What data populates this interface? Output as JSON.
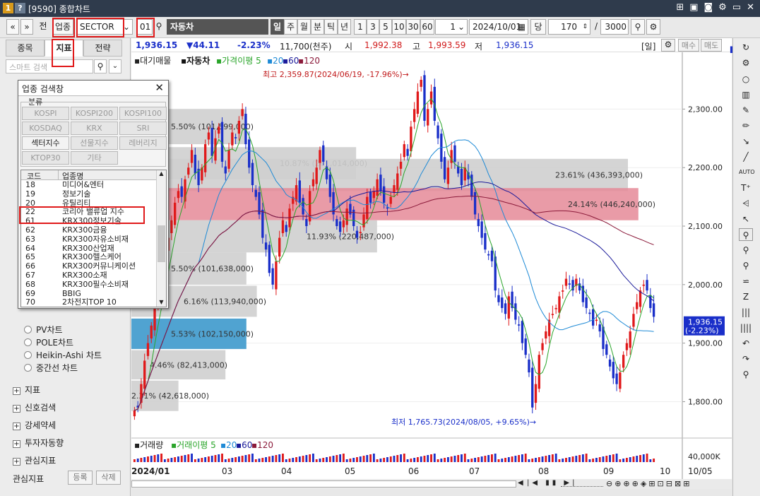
{
  "window": {
    "code": "[9590]",
    "title": "종합차트",
    "icons": [
      "pin-icon",
      "note-icon",
      "camera-icon",
      "gear-icon",
      "minimize-icon",
      "close-icon"
    ]
  },
  "toolbar": {
    "prev_label": "«",
    "next_label": "»",
    "before_label": "전",
    "type_label": "업종",
    "sector_value": "SECTOR",
    "code_value": "01",
    "name_value": "자동차",
    "period_buttons": [
      "일",
      "주",
      "월",
      "분",
      "틱",
      "년"
    ],
    "interval_buttons": [
      "1",
      "3",
      "5",
      "10",
      "30",
      "60"
    ],
    "interval_value": "1",
    "date_value": "2024/10/01",
    "unit_label": "당",
    "count_value": "170",
    "slash": "/",
    "max_value": "3000"
  },
  "quote": {
    "price": "1,936.15",
    "change": "▼44.11",
    "rate": "-2.23%",
    "volume": "11,700(천주)",
    "open_label": "시",
    "open": "1,992.38",
    "high_label": "고",
    "high": "1,993.59",
    "low_label": "저",
    "low": "1,936.15",
    "period_tag": "[일]",
    "buy_label": "매수",
    "sell_label": "매도"
  },
  "left": {
    "tabs": [
      "종목",
      "지표",
      "전략"
    ],
    "search_placeholder": "스마트 검색",
    "radios": [
      "PV차트",
      "POLE차트",
      "Heikin-Ashi 차트",
      "중간선 차트"
    ],
    "tree": [
      "지표",
      "신호검색",
      "강세약세",
      "투자자동향",
      "관심지표"
    ],
    "bottom_label": "관심지표",
    "register_label": "등록",
    "delete_label": "삭제"
  },
  "dialog": {
    "title": "업종 검색창",
    "group_label": "분류",
    "categories": [
      {
        "label": "KOSPI",
        "on": false
      },
      {
        "label": "KOSPI200",
        "on": false
      },
      {
        "label": "KOSPI100",
        "on": false
      },
      {
        "label": "KOSDAQ",
        "on": false
      },
      {
        "label": "KRX",
        "on": false
      },
      {
        "label": "SRI",
        "on": false
      },
      {
        "label": "섹터지수",
        "on": true
      },
      {
        "label": "선물지수",
        "on": false
      },
      {
        "label": "레버리지",
        "on": false
      },
      {
        "label": "KTOP30",
        "on": false
      },
      {
        "label": "기타",
        "on": false
      }
    ],
    "col_code": "코드",
    "col_name": "업종명",
    "rows": [
      {
        "code": "18",
        "name": "미디어&엔터"
      },
      {
        "code": "19",
        "name": "정보기술"
      },
      {
        "code": "20",
        "name": "유틸리티"
      },
      {
        "code": "22",
        "name": "코리아 밸류업 지수"
      },
      {
        "code": "61",
        "name": "KRX300정보기술"
      },
      {
        "code": "62",
        "name": "KRX300금융"
      },
      {
        "code": "63",
        "name": "KRX300자유소비재"
      },
      {
        "code": "64",
        "name": "KRX300산업재"
      },
      {
        "code": "65",
        "name": "KRX300헬스케어"
      },
      {
        "code": "66",
        "name": "KRX300커뮤니케이션"
      },
      {
        "code": "67",
        "name": "KRX300소재"
      },
      {
        "code": "68",
        "name": "KRX300필수소비재"
      },
      {
        "code": "69",
        "name": "BBIG"
      },
      {
        "code": "70",
        "name": "2차전지TOP 10"
      }
    ]
  },
  "legend": {
    "index_name": "대기매물",
    "stock": "자동차",
    "ma_label": "가격이평",
    "ma": [
      "5",
      "20",
      "60",
      "120"
    ],
    "volume_label": "거래량",
    "vol_ma_label": "거래이평",
    "vol_ma": [
      "5",
      "20",
      "60",
      "120"
    ]
  },
  "annotations": {
    "high_text": "최고 2,359.87(2024/06/19, -17.96%)→",
    "low_text": "최저 1,765.73(2024/08/05, +9.65%)→",
    "price_tag": "1,936.15",
    "price_tag_rate": "(-2.23%)",
    "volume_axis_label": "40,000K"
  },
  "chart_data": {
    "type": "candlestick",
    "y_ticks": [
      "2,300.00",
      "2,200.00",
      "2,100.00",
      "2,000.00",
      "1,900.00",
      "1,800.00"
    ],
    "x_ticks": [
      "2024/01",
      "03",
      "04",
      "05",
      "06",
      "07",
      "08",
      "09",
      "10",
      "10/05"
    ],
    "ylim": [
      1745,
      2385
    ],
    "volume_profile": [
      {
        "label": "5.50% (101,599,000)",
        "low": 2240,
        "high": 2300,
        "width": 0.22
      },
      {
        "label": "10.87% (201,014,000)",
        "low": 2180,
        "high": 2235,
        "width": 0.43
      },
      {
        "label": "23.61% (436,393,000)",
        "low": 2160,
        "high": 2215,
        "width": 0.95
      },
      {
        "label": "24.14% (446,240,000)",
        "low": 2110,
        "high": 2165,
        "width": 0.97
      },
      {
        "label": "11.93% (220,487,000)",
        "low": 2055,
        "high": 2110,
        "width": 0.47
      },
      {
        "label": "5.50% (101,638,000)",
        "low": 2000,
        "high": 2055,
        "width": 0.22
      },
      {
        "label": "6.16% (113,940,000)",
        "low": 1945,
        "high": 1998,
        "width": 0.24
      },
      {
        "label": "5.53% (102,150,000)",
        "low": 1890,
        "high": 1942,
        "width": 0.22
      },
      {
        "label": "4.46% (82,413,000)",
        "low": 1838,
        "high": 1888,
        "width": 0.18
      },
      {
        "label": "2.31% (42,618,000)",
        "low": 1784,
        "high": 1836,
        "width": 0.09
      }
    ],
    "close": [
      1785,
      1790,
      1830,
      1870,
      1900,
      1930,
      1960,
      1990,
      2020,
      2050,
      2080,
      2110,
      2140,
      2160,
      2150,
      2180,
      2200,
      2230,
      2190,
      2170,
      2200,
      2240,
      2260,
      2220,
      2250,
      2270,
      2210,
      2190,
      2230,
      2260,
      2250,
      2280,
      2300,
      2240,
      2200,
      2170,
      2150,
      2120,
      2080,
      2060,
      2020,
      2000,
      2040,
      2080,
      2110,
      2090,
      2130,
      2150,
      2170,
      2140,
      2120,
      2100,
      2160,
      2180,
      2200,
      2230,
      2210,
      2180,
      2150,
      2120,
      2100,
      2090,
      2110,
      2130,
      2120,
      2100,
      2080,
      2090,
      2120,
      2150,
      2140,
      2160,
      2180,
      2160,
      2140,
      2130,
      2150,
      2170,
      2190,
      2210,
      2240,
      2220,
      2270,
      2300,
      2330,
      2350,
      2280,
      2300,
      2330,
      2280,
      2250,
      2210,
      2180,
      2200,
      2230,
      2210,
      2190,
      2170,
      2200,
      2180,
      2150,
      2120,
      2100,
      2080,
      2060,
      2050,
      2040,
      1990,
      1970,
      1960,
      1950,
      1980,
      1960,
      1940,
      1930,
      1900,
      1880,
      1850,
      1790,
      1830,
      1880,
      1900,
      1920,
      1940,
      1950,
      1960,
      1980,
      1990,
      2010,
      2000,
      1990,
      2010,
      1990,
      1970,
      1960,
      1950,
      1930,
      1940,
      1920,
      1890,
      1880,
      1860,
      1840,
      1830,
      1850,
      1880,
      1900,
      1920,
      1950,
      1970,
      1990,
      2000,
      1990,
      1960,
      1945
    ]
  }
}
